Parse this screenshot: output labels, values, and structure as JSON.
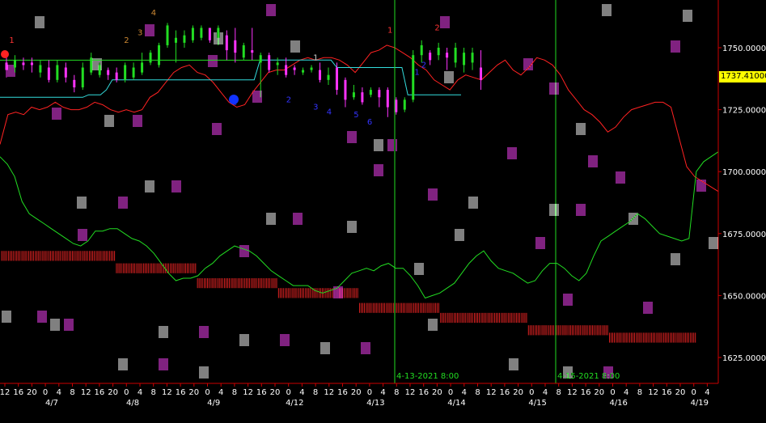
{
  "chart_data": {
    "type": "line",
    "title": "",
    "xlabel": "",
    "ylabel": "",
    "ylim": [
      1618,
      1768
    ],
    "grid": false,
    "colors": {
      "background": "#000000",
      "axis": "#cc0000",
      "price_up": "#22dd22",
      "price_down": "#ff33ff",
      "cloud_red": "#dd2222",
      "cloud_light": "#ffffff",
      "cloud_pink": "#ff44ff",
      "tenkan": "#ff2222",
      "kijun": "#33dddd",
      "chikou": "#22dd22",
      "vline": "#22dd22",
      "current_price_bg": "#ffff00"
    },
    "y_ticks": [
      "1750.00000",
      "1725.00000",
      "1700.00000",
      "1675.00000",
      "1650.00000",
      "1625.00000"
    ],
    "y_tick_values": [
      1750,
      1725,
      1700,
      1675,
      1650,
      1625
    ],
    "current_price": "1737.41000",
    "current_price_value": 1737.41,
    "x_hour_labels": [
      "12",
      "16",
      "20",
      "0",
      "4",
      "8",
      "12",
      "16",
      "20",
      "0",
      "4",
      "8",
      "12",
      "16",
      "20",
      "0",
      "4",
      "8",
      "12",
      "16",
      "20",
      "0",
      "4",
      "8",
      "12",
      "16",
      "20",
      "0",
      "4",
      "8",
      "12",
      "16",
      "20",
      "0",
      "4",
      "8",
      "12",
      "16",
      "20",
      "0",
      "4",
      "8",
      "12",
      "16",
      "20",
      "0",
      "4",
      "8",
      "12",
      "16",
      "20",
      "0",
      "4",
      "8",
      "12",
      "16",
      "20",
      "0",
      "4",
      "8",
      "12",
      "16",
      "20",
      "0",
      "4",
      "8",
      "12",
      "16",
      "20",
      "0",
      "4",
      "8",
      "12",
      "16",
      "20",
      "0",
      "4",
      "8",
      "12",
      "16",
      "20",
      "0",
      "4",
      "8",
      "12",
      "16",
      "20",
      "0",
      "4"
    ],
    "x_date_labels": [
      "4/7",
      "4/8",
      "4/9",
      "4/12",
      "4/13",
      "4/14",
      "4/15",
      "4/16",
      "4/19"
    ],
    "x_date_label_index": [
      4,
      16,
      28,
      40,
      52,
      64,
      76,
      88,
      100
    ],
    "vlines": [
      {
        "label": "4-13-2021 8:00",
        "index": 58
      },
      {
        "label": "4-15-2021 8:00",
        "index": 82
      }
    ],
    "candles": [
      {
        "i": 0,
        "o": 1744,
        "c": 1741,
        "h": 1748,
        "l": 1738
      },
      {
        "i": 1,
        "o": 1742,
        "c": 1745,
        "h": 1747,
        "l": 1740
      },
      {
        "i": 2,
        "o": 1744,
        "c": 1743,
        "h": 1746,
        "l": 1741
      },
      {
        "i": 3,
        "o": 1744,
        "c": 1743,
        "h": 1746,
        "l": 1740
      },
      {
        "i": 4,
        "o": 1740,
        "c": 1743,
        "h": 1745,
        "l": 1738
      },
      {
        "i": 5,
        "o": 1742,
        "c": 1737,
        "h": 1745,
        "l": 1736
      },
      {
        "i": 6,
        "o": 1737,
        "c": 1743,
        "h": 1745,
        "l": 1736
      },
      {
        "i": 7,
        "o": 1742,
        "c": 1738,
        "h": 1744,
        "l": 1736
      },
      {
        "i": 8,
        "o": 1737,
        "c": 1734,
        "h": 1739,
        "l": 1732
      },
      {
        "i": 9,
        "o": 1734,
        "c": 1742,
        "h": 1744,
        "l": 1733
      },
      {
        "i": 10,
        "o": 1740,
        "c": 1746,
        "h": 1748,
        "l": 1739
      },
      {
        "i": 11,
        "o": 1739,
        "c": 1743,
        "h": 1744,
        "l": 1738
      },
      {
        "i": 12,
        "o": 1741,
        "c": 1739,
        "h": 1742,
        "l": 1737
      },
      {
        "i": 13,
        "o": 1740,
        "c": 1737,
        "h": 1742,
        "l": 1736
      },
      {
        "i": 14,
        "o": 1737,
        "c": 1743,
        "h": 1744,
        "l": 1736
      },
      {
        "i": 15,
        "o": 1738,
        "c": 1742,
        "h": 1744,
        "l": 1737
      },
      {
        "i": 16,
        "o": 1740,
        "c": 1744,
        "h": 1748,
        "l": 1739
      },
      {
        "i": 17,
        "o": 1744,
        "c": 1748,
        "h": 1749,
        "l": 1743
      },
      {
        "i": 18,
        "o": 1743,
        "c": 1751,
        "h": 1752,
        "l": 1742
      },
      {
        "i": 19,
        "o": 1751,
        "c": 1759,
        "h": 1760,
        "l": 1750
      },
      {
        "i": 20,
        "o": 1752,
        "c": 1754,
        "h": 1757,
        "l": 1744
      },
      {
        "i": 21,
        "o": 1752,
        "c": 1755,
        "h": 1757,
        "l": 1750
      },
      {
        "i": 22,
        "o": 1753,
        "c": 1758,
        "h": 1759,
        "l": 1752
      },
      {
        "i": 23,
        "o": 1754,
        "c": 1758,
        "h": 1759,
        "l": 1753
      },
      {
        "i": 24,
        "o": 1758,
        "c": 1753,
        "h": 1758,
        "l": 1752
      },
      {
        "i": 25,
        "o": 1754,
        "c": 1758,
        "h": 1759,
        "l": 1751
      },
      {
        "i": 26,
        "o": 1755,
        "c": 1749,
        "h": 1757,
        "l": 1745
      },
      {
        "i": 27,
        "o": 1753,
        "c": 1748,
        "h": 1758,
        "l": 1744
      },
      {
        "i": 28,
        "o": 1746,
        "c": 1751,
        "h": 1752,
        "l": 1745
      },
      {
        "i": 29,
        "o": 1749,
        "c": 1748,
        "h": 1758,
        "l": 1745
      },
      {
        "i": 30,
        "o": 1744,
        "c": 1747,
        "h": 1748,
        "l": 1730
      },
      {
        "i": 31,
        "o": 1747,
        "c": 1741,
        "h": 1748,
        "l": 1740
      },
      {
        "i": 32,
        "o": 1743,
        "c": 1744,
        "h": 1746,
        "l": 1739
      },
      {
        "i": 33,
        "o": 1743,
        "c": 1739,
        "h": 1746,
        "l": 1738
      },
      {
        "i": 34,
        "o": 1742,
        "c": 1741,
        "h": 1743,
        "l": 1739
      },
      {
        "i": 35,
        "o": 1740,
        "c": 1741,
        "h": 1742,
        "l": 1739
      },
      {
        "i": 36,
        "o": 1741,
        "c": 1742,
        "h": 1743,
        "l": 1740
      },
      {
        "i": 37,
        "o": 1741,
        "c": 1737,
        "h": 1744,
        "l": 1736
      },
      {
        "i": 38,
        "o": 1737,
        "c": 1739,
        "h": 1742,
        "l": 1735
      },
      {
        "i": 39,
        "o": 1742,
        "c": 1733,
        "h": 1744,
        "l": 1731
      },
      {
        "i": 40,
        "o": 1737,
        "c": 1729,
        "h": 1738,
        "l": 1726
      },
      {
        "i": 41,
        "o": 1730,
        "c": 1732,
        "h": 1735,
        "l": 1729
      },
      {
        "i": 42,
        "o": 1732,
        "c": 1728,
        "h": 1734,
        "l": 1727
      },
      {
        "i": 43,
        "o": 1731,
        "c": 1733,
        "h": 1734,
        "l": 1730
      },
      {
        "i": 44,
        "o": 1733,
        "c": 1730,
        "h": 1734,
        "l": 1726
      },
      {
        "i": 45,
        "o": 1733,
        "c": 1726,
        "h": 1734,
        "l": 1722
      },
      {
        "i": 46,
        "o": 1729,
        "c": 1724,
        "h": 1730,
        "l": 1723
      },
      {
        "i": 47,
        "o": 1725,
        "c": 1729,
        "h": 1730,
        "l": 1724
      },
      {
        "i": 48,
        "o": 1729,
        "c": 1747,
        "h": 1749,
        "l": 1728
      },
      {
        "i": 49,
        "o": 1747,
        "c": 1751,
        "h": 1753,
        "l": 1744
      },
      {
        "i": 50,
        "o": 1748,
        "c": 1745,
        "h": 1749,
        "l": 1743
      },
      {
        "i": 51,
        "o": 1747,
        "c": 1750,
        "h": 1752,
        "l": 1745
      },
      {
        "i": 52,
        "o": 1748,
        "c": 1746,
        "h": 1750,
        "l": 1741
      },
      {
        "i": 53,
        "o": 1744,
        "c": 1750,
        "h": 1752,
        "l": 1742
      },
      {
        "i": 54,
        "o": 1743,
        "c": 1748,
        "h": 1750,
        "l": 1740
      },
      {
        "i": 55,
        "o": 1744,
        "c": 1748,
        "h": 1750,
        "l": 1741
      },
      {
        "i": 56,
        "o": 1742,
        "c": 1737,
        "h": 1749,
        "l": 1733
      }
    ],
    "series": [
      {
        "y": [
          1711,
          1723,
          1724,
          1723,
          1726,
          1725,
          1726,
          1728,
          1726,
          1725,
          1725,
          1726,
          1728,
          1727,
          1725,
          1724,
          1725,
          1724,
          1725,
          1730,
          1732,
          1736,
          1740,
          1742,
          1743,
          1740,
          1739,
          1736,
          1732,
          1728,
          1726,
          1727,
          1732,
          1736,
          1740,
          1741,
          1741,
          1743,
          1745,
          1746,
          1745,
          1746,
          1746,
          1745,
          1743,
          1740,
          1744,
          1748,
          1749,
          1751,
          1750,
          1748,
          1746,
          1743,
          1741,
          1737,
          1735,
          1733,
          1737,
          1739,
          1738,
          1737,
          1740,
          1743,
          1745,
          1741,
          1739,
          1742,
          1746,
          1745,
          1743,
          1739,
          1733,
          1729,
          1725,
          1723,
          1720,
          1716,
          1718,
          1722,
          1725,
          1726,
          1727,
          1728,
          1728,
          1726,
          1714,
          1702,
          1698,
          1696,
          1694,
          1692
        ]
      },
      {
        "y": [
          1730,
          1730,
          1730,
          1730,
          1730,
          1730,
          1730,
          1730,
          1730,
          1730,
          1730,
          1730,
          1730,
          1730,
          1730,
          1731,
          1731,
          1731,
          1733,
          1737,
          1737,
          1737,
          1737,
          1737,
          1737,
          1737,
          1737,
          1737,
          1737,
          1737,
          1737,
          1737,
          1737,
          1737,
          1737,
          1737,
          1737,
          1737,
          1737,
          1737,
          1737,
          1737,
          1737,
          1737,
          1745,
          1745,
          1745,
          1745,
          1745,
          1745,
          1745,
          1745,
          1745,
          1745,
          1745,
          1745,
          1745,
          1742,
          1742,
          1742,
          1742,
          1742,
          1742,
          1742,
          1742,
          1742,
          1742,
          1742,
          1742,
          1731,
          1731,
          1731,
          1731,
          1731,
          1731,
          1731,
          1731,
          1731,
          1731
        ]
      },
      {
        "y": [
          1706,
          1703,
          1698,
          1688,
          1683,
          1681,
          1679,
          1677,
          1675,
          1673,
          1671,
          1670,
          1672,
          1676,
          1676,
          1677,
          1677,
          1675,
          1673,
          1672,
          1670,
          1667,
          1663,
          1659,
          1656,
          1657,
          1657,
          1658,
          1661,
          1663,
          1666,
          1668,
          1670,
          1669,
          1668,
          1666,
          1663,
          1660,
          1658,
          1656,
          1654,
          1654,
          1654,
          1652,
          1651,
          1652,
          1653,
          1656,
          1659,
          1660,
          1661,
          1660,
          1662,
          1663,
          1661,
          1661,
          1658,
          1654,
          1649,
          1650,
          1651,
          1653,
          1655,
          1659,
          1663,
          1666,
          1668,
          1664,
          1661,
          1660,
          1659,
          1657,
          1655,
          1656,
          1660,
          1663,
          1663,
          1661,
          1658,
          1656,
          1659,
          1666,
          1672,
          1674,
          1676,
          1678,
          1680,
          1683,
          1681,
          1678,
          1675,
          1674,
          1673,
          1672,
          1673,
          1700,
          1704,
          1706,
          1708
        ]
      }
    ],
    "cloud_red_steps": [
      {
        "from": 0,
        "to": 17,
        "y": 1668,
        "h": 4
      },
      {
        "from": 17,
        "to": 29,
        "y": 1663,
        "h": 4
      },
      {
        "from": 29,
        "to": 41,
        "y": 1657,
        "h": 4
      },
      {
        "from": 41,
        "to": 53,
        "y": 1653,
        "h": 4
      },
      {
        "from": 53,
        "to": 65,
        "y": 1647,
        "h": 4
      },
      {
        "from": 65,
        "to": 78,
        "y": 1643,
        "h": 4
      },
      {
        "from": 78,
        "to": 90,
        "y": 1638,
        "h": 4
      },
      {
        "from": 90,
        "to": 103,
        "y": 1635,
        "h": 4
      }
    ],
    "markers": [
      {
        "label": "1",
        "index": 1,
        "y": 1752,
        "color": "#ff3333"
      },
      {
        "label": "2",
        "index": 18,
        "y": 1752,
        "color": "#cc8833"
      },
      {
        "label": "3",
        "index": 20,
        "y": 1755,
        "color": "#cc8833"
      },
      {
        "label": "4",
        "index": 22,
        "y": 1763,
        "color": "#cc8833"
      },
      {
        "label": "1",
        "index": 34,
        "y": 1727,
        "color": "#3333ff"
      },
      {
        "label": "2",
        "index": 42,
        "y": 1728,
        "color": "#3333ff"
      },
      {
        "label": "3",
        "index": 46,
        "y": 1725,
        "color": "#3333ff"
      },
      {
        "label": "4",
        "index": 48,
        "y": 1723,
        "color": "#3333ff"
      },
      {
        "label": "5",
        "index": 52,
        "y": 1722,
        "color": "#3333ff"
      },
      {
        "label": "6",
        "index": 54,
        "y": 1719,
        "color": "#3333ff"
      },
      {
        "label": "1",
        "index": 46,
        "y": 1745,
        "color": "#cccccc"
      },
      {
        "label": "1",
        "index": 57,
        "y": 1756,
        "color": "#ff3333"
      },
      {
        "label": "2",
        "index": 64,
        "y": 1757,
        "color": "#ff3333"
      },
      {
        "label": "1",
        "index": 61,
        "y": 1739,
        "color": "#3333ff"
      },
      {
        "label": "2",
        "index": 62,
        "y": 1742,
        "color": "#3333ff"
      }
    ]
  }
}
